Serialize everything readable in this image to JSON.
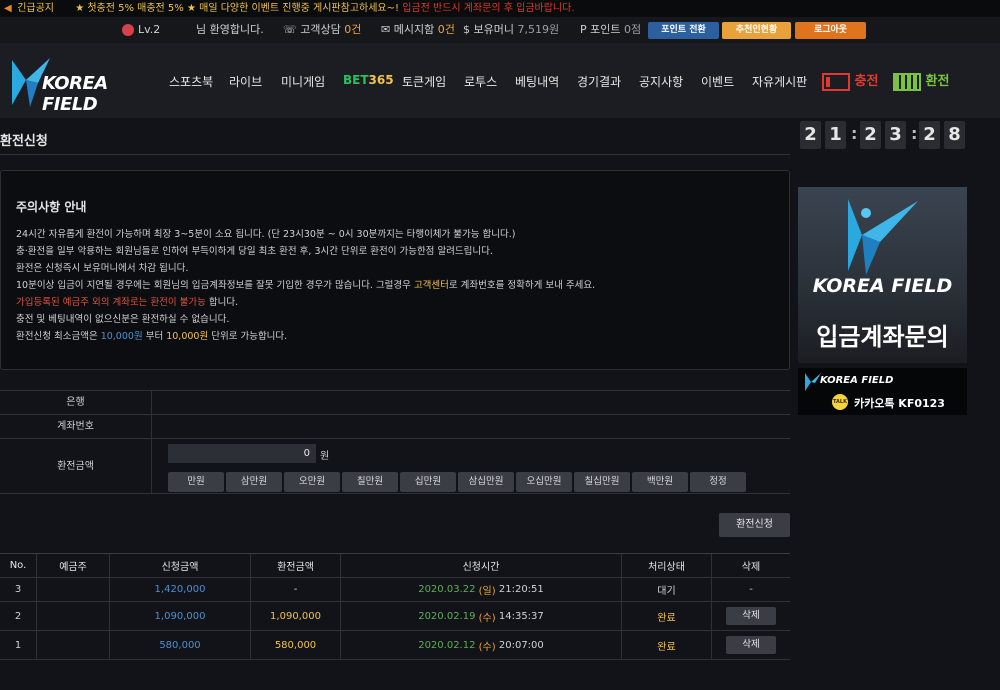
{
  "notice": {
    "tag": "긴급공지",
    "message": "★ 첫충전 5% 매충전 5% ★ 매일 다양한 이벤트 진행중 게시판참고하세요~!",
    "message_red": "입금전 반드시 계좌문의 후 입금바랍니다."
  },
  "userbar": {
    "level": "Lv.2",
    "welcome": "님 환영합니다.",
    "consult_label": "고객상담",
    "consult_count": "0건",
    "message_label": "메시지함",
    "message_count": "0건",
    "money_label": "보유머니",
    "money_value": "7,519원",
    "point_label": "포인트",
    "point_value": "0점",
    "point_convert": "포인트 전환",
    "referral": "추천인현황",
    "logout": "로그아웃"
  },
  "header": {
    "logo": "KOREA FIELD",
    "nav": [
      "스포츠북",
      "라이브",
      "미니게임",
      "BET",
      "365",
      "토큰게임",
      "로투스",
      "베팅내역",
      "경기결과",
      "공지사항",
      "이벤트",
      "자유게시판"
    ],
    "charge": "충전",
    "exchange": "환전"
  },
  "clock": [
    "2",
    "1",
    "2",
    "3",
    "2",
    "8"
  ],
  "page": {
    "title": "환전신청"
  },
  "info": {
    "heading": "주의사항 안내",
    "line1": "24시간 자유롭게 환전이 가능하며 최장 3~5분이 소요 됩니다. (단 23시30분 ~ 0시 30분까지는 타행이체가 불가능 합니다.)",
    "line2": "충·환전을 일부 악용하는 회원님들로 인하여 부득이하게 당일 최초 환전 후, 3시간 단위로 환전이 가능한점 알려드립니다.",
    "line3": "환전은 신청즉시 보유머니에서 차감 됩니다.",
    "line4a": "10분이상 입금이 지연될 경우에는 회원님의 입금계좌정보를 잘못 기입한 경우가 많습니다. 그럴경우 ",
    "line4b": "고객센터",
    "line4c": "로 계좌번호를 정확하게 보내 주세요.",
    "line5a": "가입등록된 예금주 외의 계좌로는 환전이 불가능",
    "line5b": " 합니다.",
    "line6": "충전 및 베팅내역이 없으신분은 환전하실 수 없습니다.",
    "line7a": "환전신청 최소금액은 ",
    "line7b": "10,000원",
    "line7c": " 부터 ",
    "line7d": "10,000원",
    "line7e": " 단위로 가능합니다."
  },
  "form": {
    "bank_label": "은행",
    "account_label": "계좌번호",
    "amount_label": "환전금액",
    "amount_value": "0",
    "won": "원",
    "buttons": [
      "만원",
      "삼만원",
      "오만원",
      "칠만원",
      "십만원",
      "삼십만원",
      "오십만원",
      "칠십만원",
      "백만원",
      "정정"
    ],
    "submit": "환전신청"
  },
  "list": {
    "headers": [
      "No.",
      "예금주",
      "신청금액",
      "환전금액",
      "신청시간",
      "처리상태",
      "삭제"
    ],
    "rows": [
      {
        "no": "3",
        "request": "1,420,000",
        "exchange": "-",
        "date": "2020.03.22",
        "day": "(일)",
        "time": "21:20:51",
        "status": "대기",
        "delete": "-"
      },
      {
        "no": "2",
        "request": "1,090,000",
        "exchange": "1,090,000",
        "date": "2020.02.19",
        "day": "(수)",
        "time": "14:35:37",
        "status": "완료",
        "delete": "삭제"
      },
      {
        "no": "1",
        "request": "580,000",
        "exchange": "580,000",
        "date": "2020.02.12",
        "day": "(수)",
        "time": "20:07:00",
        "status": "완료",
        "delete": "삭제"
      }
    ]
  },
  "banner": {
    "logo": "KOREA FIELD",
    "subtitle": "입금계좌문의",
    "logo2": "KOREA FIELD",
    "talk": "TALK",
    "kakao": "카카오톡 KF0123"
  },
  "colors": {
    "accent_yellow": "#f2c34a",
    "accent_blue": "#4f8fd0",
    "charge_red": "#e03a2f",
    "exchange_green": "#7cc242"
  }
}
